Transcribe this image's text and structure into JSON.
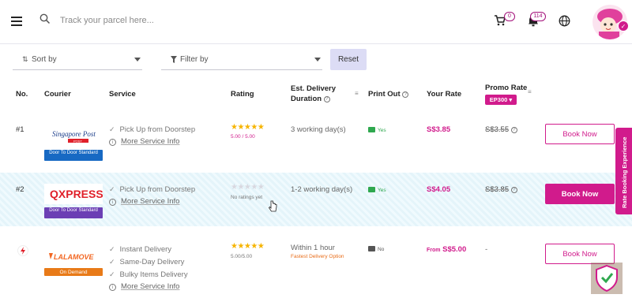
{
  "header": {
    "search_placeholder": "Track your parcel here...",
    "cart_count": "0",
    "notification_count": "114"
  },
  "filters": {
    "sort_label": "Sort by",
    "filter_label": "Filter by",
    "reset_label": "Reset"
  },
  "columns": {
    "no": "No.",
    "courier": "Courier",
    "service": "Service",
    "rating": "Rating",
    "delivery_line1": "Est. Delivery",
    "delivery_line2": "Duration",
    "print_out": "Print Out",
    "your_rate": "Your Rate",
    "promo_rate": "Promo Rate",
    "promo_code": "EP300"
  },
  "rows": [
    {
      "no": "#1",
      "courier_logo_text": "Singapore Post",
      "tag": "Door To Door Standard",
      "tag_color": "#1769c3",
      "services": [
        "Pick Up from Doorstep"
      ],
      "more_info": "More Service Info",
      "rating_text": "5.00 / 5.00",
      "duration": "3 working day(s)",
      "duration_note": "",
      "print": "Yes",
      "rate_prefix": "",
      "rate": "S$3.85",
      "promo": "S$3.55",
      "book": "Book Now"
    },
    {
      "no": "#2",
      "courier_logo_text": "QXPRESS",
      "tag": "Door To Door Standard",
      "tag_color": "#6b3fb4",
      "services": [
        "Pick Up from Doorstep"
      ],
      "more_info": "More Service Info",
      "rating_text": "No ratings yet",
      "duration": "1-2 working day(s)",
      "duration_note": "",
      "print": "Yes",
      "rate_prefix": "",
      "rate": "S$4.05",
      "promo": "S$3.85",
      "book": "Book Now"
    },
    {
      "no": "",
      "courier_logo_text": "LALAMOVE",
      "tag": "On Demand",
      "tag_color": "#e87a18",
      "services": [
        "Instant Delivery",
        "Same-Day Delivery",
        "Bulky Items Delivery"
      ],
      "more_info": "More Service Info",
      "rating_text": "5.00/5.00",
      "duration": "Within 1 hour",
      "duration_note": "Fastest Delivery Option",
      "print": "No",
      "rate_prefix": "From",
      "rate": "S$5.00",
      "promo": "-",
      "book": "Book Now"
    }
  ],
  "side_tab": "Rate Booking Experience",
  "colors": {
    "brand": "#d11b8c",
    "star": "#f6b400",
    "green": "#2fa84f"
  }
}
